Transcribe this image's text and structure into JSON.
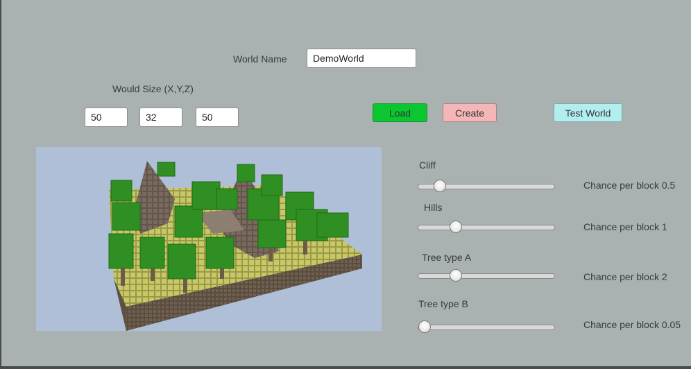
{
  "world_name": {
    "label": "World Name",
    "value": "DemoWorld"
  },
  "world_size": {
    "label": "Would Size (X,Y,Z)",
    "x": "50",
    "y": "32",
    "z": "50"
  },
  "buttons": {
    "load": "Load",
    "create": "Create",
    "test_world": "Test World"
  },
  "colors": {
    "background": "#a9b1b1",
    "load_button": "#0ac630",
    "create_button": "#f4b6b6",
    "test_world_button": "#b2eef0",
    "preview_sky": "#afbfd7"
  },
  "preview": {
    "description_icon": "voxel-world-preview"
  },
  "sliders": [
    {
      "label": "Cliff",
      "chance_text": "Chance per block 0.5",
      "position": 0.16
    },
    {
      "label": "Hills",
      "chance_text": "Chance per block 1",
      "position": 0.28
    },
    {
      "label": "Tree type A",
      "chance_text": "Chance per block 2",
      "position": 0.28
    },
    {
      "label": "Tree type B",
      "chance_text": "Chance per block 0.05",
      "position": 0.05
    }
  ]
}
